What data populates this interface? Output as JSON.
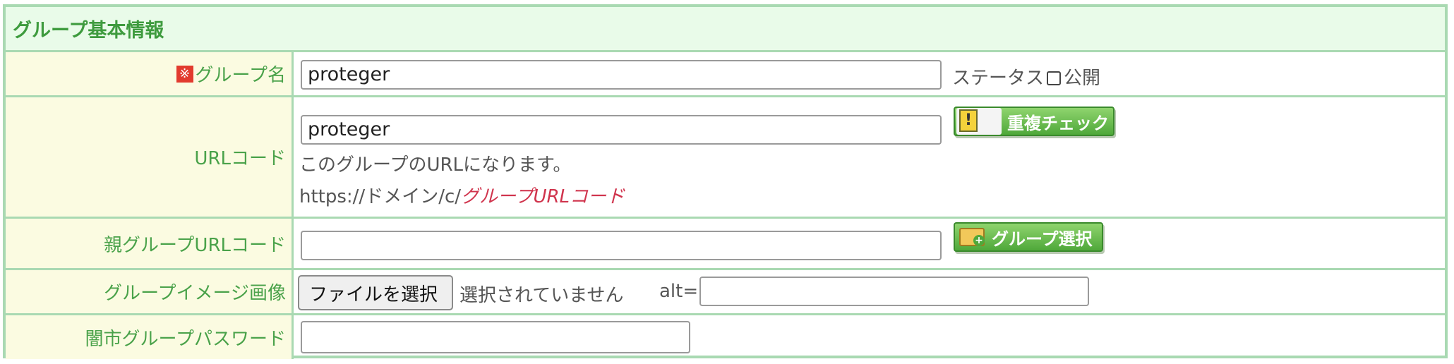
{
  "section": {
    "title": "グループ基本情報"
  },
  "rows": {
    "group_name": {
      "required_mark": "※",
      "label": "グループ名",
      "value": "proteger",
      "status_label": "ステータス",
      "public_label": "公開"
    },
    "url_code": {
      "label": "URLコード",
      "value": "proteger",
      "dup_check_button": "重複チェック",
      "help_text": "このグループのURLになります。",
      "url_prefix": "https://ドメイン/c/",
      "url_placeholder": "グループURLコード"
    },
    "parent_url_code": {
      "label": "親グループURLコード",
      "value": "",
      "select_button": "グループ選択"
    },
    "group_image": {
      "label": "グループイメージ画像",
      "file_button": "ファイルを選択",
      "file_status": "選択されていません",
      "alt_label": "alt=",
      "alt_value": ""
    },
    "password": {
      "label": "闇市グループパスワード",
      "value": ""
    }
  },
  "colors": {
    "border": "#a9d9b2",
    "header_bg": "#e9fbe9",
    "label_bg": "#fbfbe1",
    "label_text": "#4aa24a",
    "button_green": "#4fa83a",
    "required_red": "#e23b2e",
    "url_red": "#d0344d"
  },
  "icons": {
    "dup_check": "warning-document-icon",
    "group_select": "folder-add-icon"
  }
}
